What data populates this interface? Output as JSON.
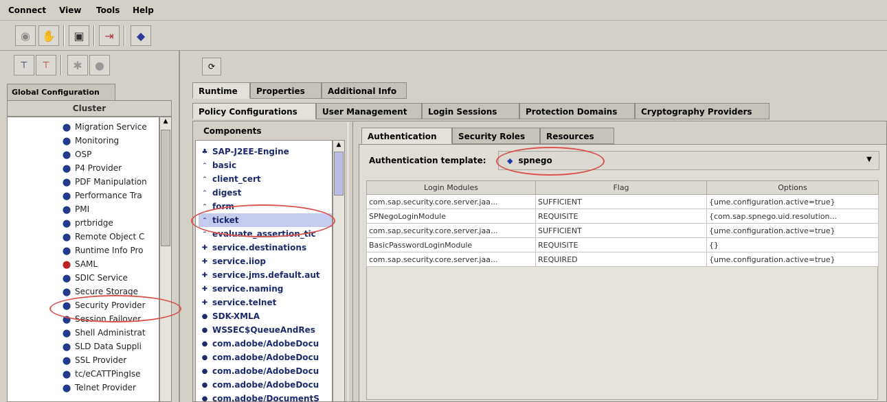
{
  "menu": [
    "Connect",
    "View",
    "Tools",
    "Help"
  ],
  "toolbar": {
    "icons": [
      "connect-icon",
      "disconnect-icon",
      "window-icon",
      "exit-icon",
      "key-icon"
    ]
  },
  "left": {
    "tool_icons": [
      "tree-icon",
      "tree-alt-icon",
      "run-icon",
      "stop-icon"
    ],
    "tab": "Global Configuration",
    "cluster": "Cluster",
    "tree_items": [
      "Migration Service",
      "Monitoring",
      "OSP",
      "P4 Provider",
      "PDF Manipulation",
      "Performance Tra",
      "PMI",
      "prtbridge",
      "Remote Object C",
      "Runtime Info Pro",
      "SAML",
      "SDIC Service",
      "Secure Storage",
      "Security Provider",
      "Session Failover",
      "Shell Administrat",
      "SLD Data Suppli",
      "SSL Provider",
      "tc/eCATTPingIse",
      "Telnet Provider"
    ]
  },
  "right": {
    "main_tabs": [
      "Runtime",
      "Properties",
      "Additional Info"
    ],
    "sub_tabs": [
      "Policy Configurations",
      "User Management",
      "Login Sessions",
      "Protection Domains",
      "Cryptography Providers"
    ],
    "components_header": "Components",
    "components": [
      "SAP-J2EE-Engine",
      "basic",
      "client_cert",
      "digest",
      "form",
      "ticket",
      "evaluate_assertion_tic",
      "service.destinations",
      "service.iiop",
      "service.jms.default.aut",
      "service.naming",
      "service.telnet",
      "SDK-XMLA",
      "WSSEC$QueueAndRes",
      "com.adobe/AdobeDocu",
      "com.adobe/AdobeDocu",
      "com.adobe/AdobeDocu",
      "com.adobe/AdobeDocu",
      "com.adobe/DocumentS"
    ],
    "auth_tabs": [
      "Authentication",
      "Security Roles",
      "Resources"
    ],
    "template_label": "Authentication template:",
    "template_value": "spnego",
    "table": {
      "headers": [
        "Login Modules",
        "Flag",
        "Options"
      ],
      "rows": [
        [
          "com.sap.security.core.server.jaa...",
          "SUFFICIENT",
          "{ume.configuration.active=true}"
        ],
        [
          "SPNegoLoginModule",
          "REQUISITE",
          "{com.sap.spnego.uid.resolution..."
        ],
        [
          "com.sap.security.core.server.jaa...",
          "SUFFICIENT",
          "{ume.configuration.active=true}"
        ],
        [
          "BasicPasswordLoginModule",
          "REQUISITE",
          "{}"
        ],
        [
          "com.sap.security.core.server.jaa...",
          "REQUIRED",
          "{ume.configuration.active=true}"
        ]
      ]
    }
  },
  "colors": {
    "highlight_circle": "#d9534f",
    "selection": "#c5cbee",
    "window_bg": "#d4d0c8"
  }
}
